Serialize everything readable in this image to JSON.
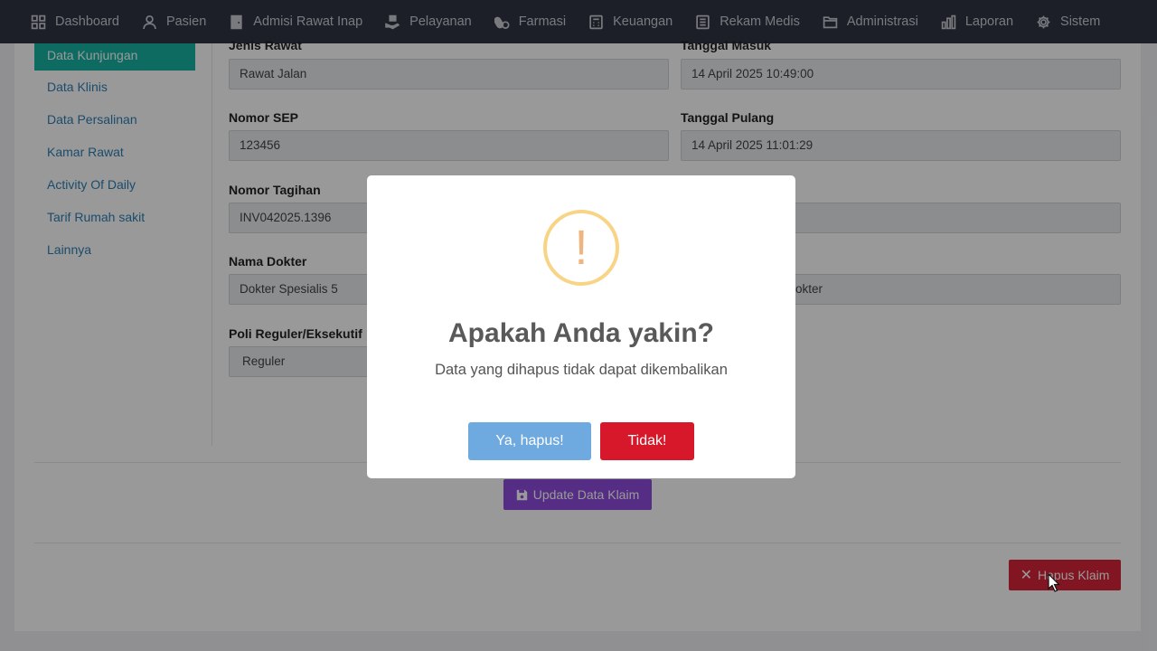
{
  "nav": {
    "items": [
      {
        "label": "Dashboard",
        "icon": "grid-icon"
      },
      {
        "label": "Pasien",
        "icon": "user-icon"
      },
      {
        "label": "Admisi Rawat Inap",
        "icon": "door-icon"
      },
      {
        "label": "Pelayanan",
        "icon": "hand-box-icon"
      },
      {
        "label": "Farmasi",
        "icon": "pills-icon"
      },
      {
        "label": "Keuangan",
        "icon": "calculator-icon"
      },
      {
        "label": "Rekam Medis",
        "icon": "book-icon"
      },
      {
        "label": "Administrasi",
        "icon": "folder-icon"
      },
      {
        "label": "Laporan",
        "icon": "bar-chart-icon"
      },
      {
        "label": "Sistem",
        "icon": "gear-icon"
      }
    ]
  },
  "sidebar": {
    "items": [
      {
        "label": "Data Kunjungan",
        "active": true
      },
      {
        "label": "Data Klinis"
      },
      {
        "label": "Data Persalinan"
      },
      {
        "label": "Kamar Rawat"
      },
      {
        "label": "Activity Of Daily"
      },
      {
        "label": "Tarif Rumah sakit"
      },
      {
        "label": "Lainnya"
      }
    ]
  },
  "form": {
    "jenis_rawat": {
      "label": "Jenis Rawat",
      "value": "Rawat Jalan"
    },
    "tanggal_masuk": {
      "label": "Tanggal Masuk",
      "value": "14 April 2025 10:49:00"
    },
    "nomor_sep": {
      "label": "Nomor SEP",
      "value": "123456"
    },
    "tanggal_pulang": {
      "label": "Tanggal Pulang",
      "value": "14 April 2025 11:01:29"
    },
    "nomor_tagihan": {
      "label": "Nomor Tagihan",
      "value": "INV042025.1396"
    },
    "nama_dokter": {
      "label": "Nama Dokter",
      "value": "Dokter Spesialis 5"
    },
    "right_dokter": {
      "value": "okter"
    },
    "poli": {
      "label": "Poli Reguler/Eksekutif",
      "value": "Reguler"
    }
  },
  "buttons": {
    "update": "Update Data Klaim",
    "hapus": "Hapus Klaim"
  },
  "dialog": {
    "icon": "!",
    "title": "Apakah Anda yakin?",
    "text": "Data yang dihapus tidak dapat dikembalikan",
    "confirm": "Ya, hapus!",
    "cancel": "Tidak!"
  },
  "colors": {
    "nav_bg": "#2f3542",
    "sidebar_active": "#17b3a3",
    "update_button": "#8f4bdc",
    "delete_button": "#d9243a",
    "confirm_button": "#6ea9e0",
    "cancel_button": "#d7182a",
    "warning": "#f8d486"
  }
}
